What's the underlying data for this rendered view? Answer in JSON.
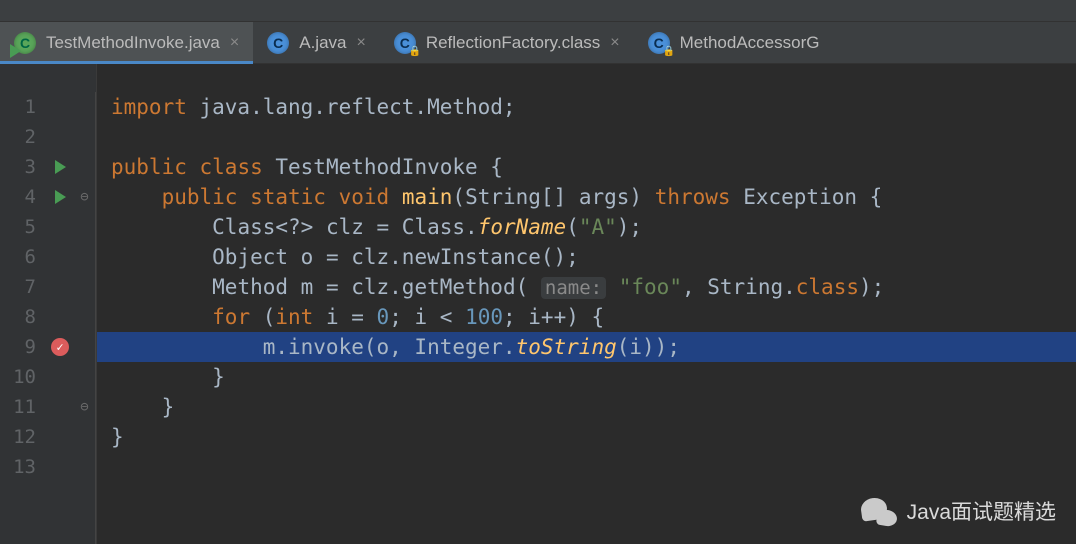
{
  "tabs": [
    {
      "label": "TestMethodInvoke.java",
      "iconClass": "java-icon",
      "runnable": true,
      "locked": false,
      "closeable": true,
      "active": true
    },
    {
      "label": "A.java",
      "iconClass": "java-icon decoding",
      "runnable": false,
      "locked": false,
      "closeable": true,
      "active": false
    },
    {
      "label": "ReflectionFactory.class",
      "iconClass": "java-icon decoding",
      "runnable": false,
      "locked": true,
      "closeable": true,
      "active": false
    },
    {
      "label": "MethodAccessorG",
      "iconClass": "java-icon decoding",
      "runnable": false,
      "locked": true,
      "closeable": false,
      "active": false
    }
  ],
  "gutter": {
    "lines": [
      "1",
      "2",
      "3",
      "4",
      "5",
      "6",
      "7",
      "8",
      "9",
      "10",
      "11",
      "12",
      "13"
    ],
    "runMarkers": [
      3,
      4
    ],
    "breakpointLine": 9,
    "foldOpen": [
      4
    ],
    "foldClose": [
      11
    ]
  },
  "code": {
    "hlLine": 9,
    "l1": {
      "kw": "import",
      "rest": " java.lang.reflect.Method;"
    },
    "l3a": "public",
    "l3b": "class",
    "l3c": " TestMethodInvoke {",
    "l4a": "public",
    "l4b": "static",
    "l4c": "void",
    "l4d": "main",
    "l4e": "(String[] args) ",
    "l4f": "throws",
    "l4g": " Exception {",
    "l5a": "Class<?> clz = Class.",
    "l5b": "forName",
    "l5c": "(",
    "l5d": "\"A\"",
    "l5e": ");",
    "l6": "Object o = clz.newInstance();",
    "l7a": "Method m = clz.getMethod( ",
    "l7hint": "name:",
    "l7b": " ",
    "l7c": "\"foo\"",
    "l7d": ", String.",
    "l7e": "class",
    "l7f": ");",
    "l8a": "for",
    "l8b": " (",
    "l8c": "int",
    "l8d": " i = ",
    "l8e": "0",
    "l8f": "; i < ",
    "l8g": "100",
    "l8h": "; i++) {",
    "l9a": "m.invoke(o, Integer.",
    "l9b": "toString",
    "l9c": "(i));",
    "l10": "}",
    "l11": "}",
    "l12": "}"
  },
  "watermark": "Java面试题精选"
}
